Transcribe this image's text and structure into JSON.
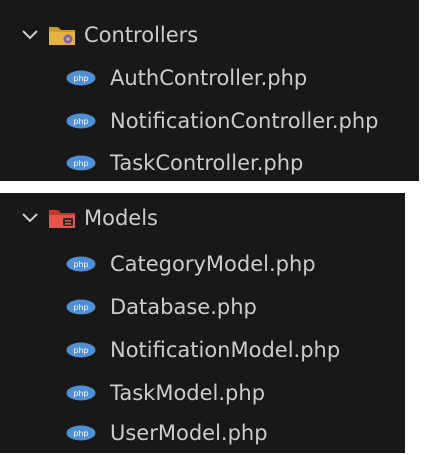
{
  "explorer": {
    "folders": [
      {
        "name": "Controllers",
        "icon": "folder-controller-icon",
        "color": "#e3b341",
        "files": [
          {
            "name": "AuthController.php",
            "icon": "php-icon"
          },
          {
            "name": "NotificationController.php",
            "icon": "php-icon"
          },
          {
            "name": "TaskController.php",
            "icon": "php-icon"
          }
        ]
      },
      {
        "name": "Models",
        "icon": "folder-model-icon",
        "color": "#e5534b",
        "files": [
          {
            "name": "CategoryModel.php",
            "icon": "php-icon"
          },
          {
            "name": "Database.php",
            "icon": "php-icon"
          },
          {
            "name": "NotificationModel.php",
            "icon": "php-icon"
          },
          {
            "name": "TaskModel.php",
            "icon": "php-icon"
          },
          {
            "name": "UserModel.php",
            "icon": "php-icon"
          }
        ]
      }
    ]
  },
  "colors": {
    "background": "#181818",
    "text": "#cccccc",
    "php_badge": "#4f8fd6"
  }
}
